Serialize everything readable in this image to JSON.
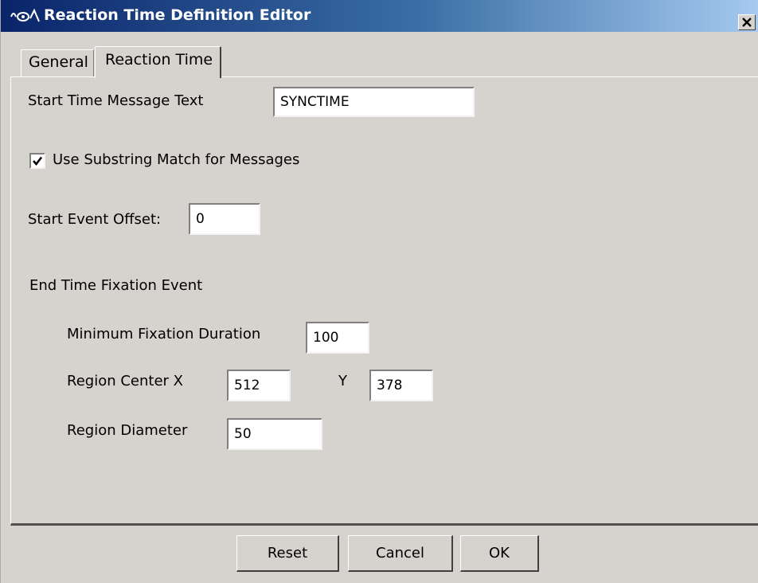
{
  "window": {
    "title": "Reaction Time Definition Editor",
    "icon": "eye-waveform-icon"
  },
  "tabs": [
    {
      "label": "General",
      "selected": false
    },
    {
      "label": "Reaction Time",
      "selected": true
    }
  ],
  "form": {
    "start_message_label": "Start Time Message Text",
    "start_message_value": "SYNCTIME",
    "substring_checkbox_label": "Use Substring Match for Messages",
    "substring_checked": true,
    "start_offset_label": "Start Event Offset:",
    "start_offset_value": "0",
    "end_section_label": "End Time Fixation Event",
    "min_duration_label": "Minimum Fixation Duration",
    "min_duration_value": "100",
    "region_center_x_label": "Region Center X",
    "region_center_x_value": "512",
    "region_center_y_label": "Y",
    "region_center_y_value": "378",
    "region_diameter_label": "Region Diameter",
    "region_diameter_value": "50"
  },
  "buttons": {
    "reset": "Reset",
    "cancel": "Cancel",
    "ok": "OK"
  },
  "colors": {
    "titlebar_start": "#0a246a",
    "titlebar_end": "#a6caf0",
    "dialog_bg": "#d6d3ce"
  }
}
